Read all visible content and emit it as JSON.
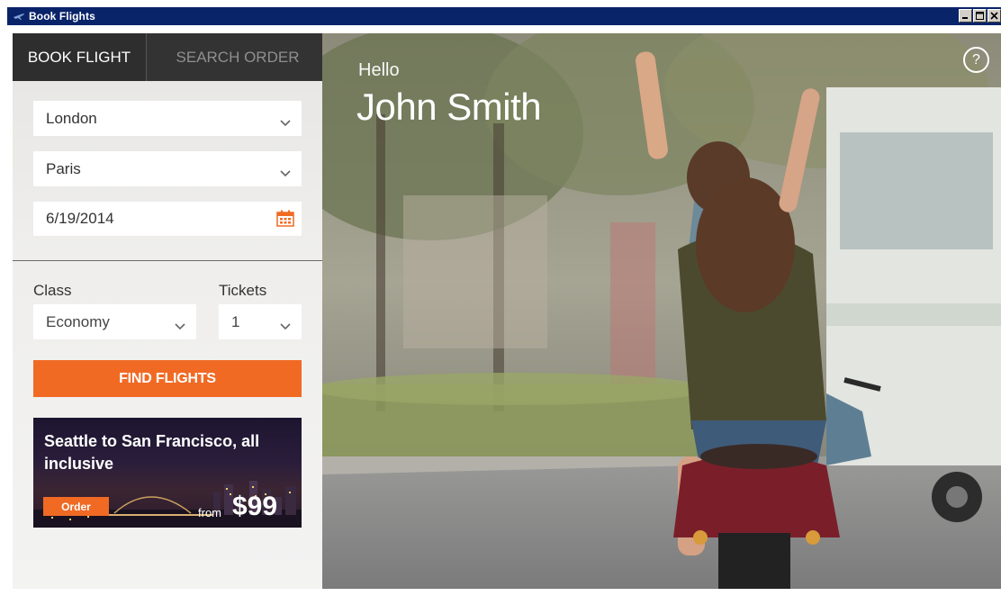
{
  "window": {
    "title": "Book Flights"
  },
  "tabs": [
    {
      "label": "BOOK FLIGHT",
      "active": true
    },
    {
      "label": "SEARCH ORDER",
      "active": false
    }
  ],
  "form": {
    "from": "London",
    "to": "Paris",
    "date": "6/19/2014",
    "class_label": "Class",
    "class_value": "Economy",
    "tickets_label": "Tickets",
    "tickets_value": "1",
    "find_button": "FIND FLIGHTS"
  },
  "promo": {
    "title": "Seattle to San Francisco, all inclusive",
    "order_button": "Order",
    "from_label": "from",
    "price": "$99"
  },
  "hero": {
    "greeting": "Hello",
    "user_name": "John Smith",
    "help_glyph": "?"
  },
  "colors": {
    "accent": "#f06a24",
    "tab_active_bg": "#2e2e2e",
    "titlebar": "#0a246a"
  },
  "icons": [
    "app-icon",
    "minimize-icon",
    "maximize-icon",
    "close-icon",
    "chevron-down-icon",
    "calendar-icon",
    "help-icon"
  ]
}
